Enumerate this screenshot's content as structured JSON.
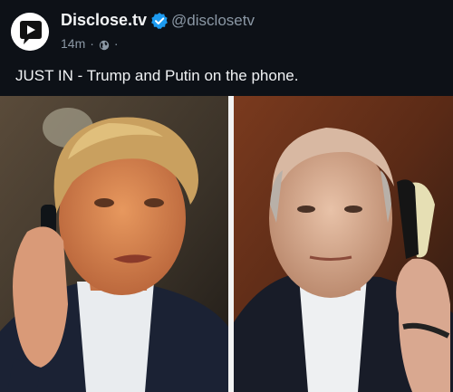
{
  "post": {
    "author": {
      "display_name": "Disclose.tv",
      "handle": "@disclosetv",
      "verified": true,
      "verified_icon": "verified-badge-icon",
      "avatar_icon": "play-logo-icon"
    },
    "meta": {
      "time": "14m",
      "separator": "·",
      "visibility_icon": "globe-icon"
    },
    "text": "JUST IN - Trump and Putin on the phone.",
    "media": {
      "left_photo": "man-on-phone-photo-left",
      "right_photo": "man-on-phone-photo-right"
    }
  },
  "colors": {
    "background": "#0d1117",
    "verified_blue": "#1d9bf0",
    "secondary_text": "#8b98a5",
    "primary_text": "#e7e9ea"
  }
}
